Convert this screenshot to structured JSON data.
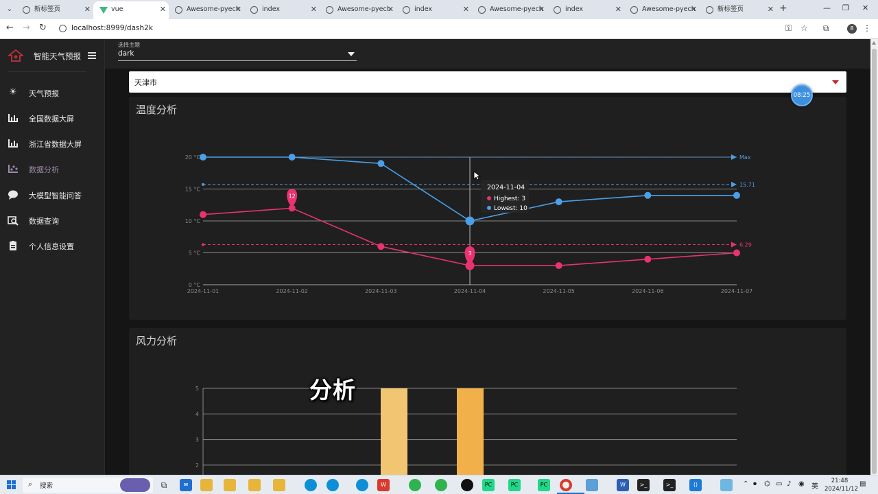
{
  "browser": {
    "tabs": [
      {
        "title": "新标签页"
      },
      {
        "title": "vue"
      },
      {
        "title": "Awesome-pyech"
      },
      {
        "title": "index"
      },
      {
        "title": "Awesome-pyech"
      },
      {
        "title": "index"
      },
      {
        "title": "Awesome-pyech"
      },
      {
        "title": "index"
      },
      {
        "title": "Awesome-pyech"
      },
      {
        "title": "新标签页"
      }
    ],
    "url": "localhost:8999/dash2k",
    "profile_initial": "8"
  },
  "sidebar": {
    "brand": "智能天气预报",
    "items": [
      {
        "label": "天气预报",
        "icon": "sun-icon"
      },
      {
        "label": "全国数据大屏",
        "icon": "bar-chart-icon"
      },
      {
        "label": "浙江省数据大屏",
        "icon": "bar-chart-icon"
      },
      {
        "label": "数据分析",
        "icon": "analytics-icon",
        "active": true
      },
      {
        "label": "大模型智能问答",
        "icon": "chat-bubble-icon"
      },
      {
        "label": "数据查询",
        "icon": "search-data-icon"
      },
      {
        "label": "个人信息设置",
        "icon": "clipboard-icon"
      }
    ]
  },
  "theme": {
    "caption": "选择主题",
    "value": "dark"
  },
  "city": {
    "value": "天津市"
  },
  "clock_badge": "08:25",
  "temperature_card": {
    "title": "温度分析"
  },
  "wind_card": {
    "title": "风力分析"
  },
  "overlay_caption": "分析",
  "tooltip": {
    "date": "2024-11-04",
    "highest_label": "Highest: 3",
    "lowest_label": "Lowest: 10"
  },
  "chart_data": [
    {
      "type": "line",
      "x": [
        "2024-11-01",
        "2024-11-02",
        "2024-11-03",
        "2024-11-04",
        "2024-11-05",
        "2024-11-06",
        "2024-11-07"
      ],
      "series": [
        {
          "name": "Highest",
          "values": [
            11,
            12,
            6,
            3,
            3,
            4,
            5
          ],
          "color": "#e8336f"
        },
        {
          "name": "Lowest",
          "values": [
            20,
            20,
            19,
            10,
            13,
            14,
            14
          ],
          "color": "#4a9fe8"
        }
      ],
      "y_ticks": [
        "0 °C",
        "5 °C",
        "10 °C",
        "15 °C",
        "20 °C"
      ],
      "ylim": [
        0,
        20
      ],
      "mark_points": [
        {
          "series": "Highest",
          "x": "2024-11-02",
          "value": 12,
          "label": "12"
        },
        {
          "series": "Highest",
          "x": "2024-11-04",
          "value": 3,
          "label": "3"
        }
      ],
      "mark_lines": [
        {
          "series": "Lowest",
          "value": 20,
          "label": "Max"
        },
        {
          "series": "Lowest",
          "value": 15.71,
          "label": "15.71"
        },
        {
          "series": "Highest",
          "value": 6.29,
          "label": "6.29"
        }
      ]
    },
    {
      "type": "bar",
      "y_ticks": [
        "2",
        "3",
        "4",
        "5"
      ],
      "ylim": [
        0,
        5
      ],
      "series": [
        {
          "color": "#f2c572",
          "values": [
            5
          ]
        },
        {
          "color": "#f2b04a",
          "values": [
            5
          ]
        }
      ]
    }
  ],
  "taskbar": {
    "search_label": "搜索",
    "time": "21:48",
    "date": "2024/11/12",
    "ime": "英"
  }
}
